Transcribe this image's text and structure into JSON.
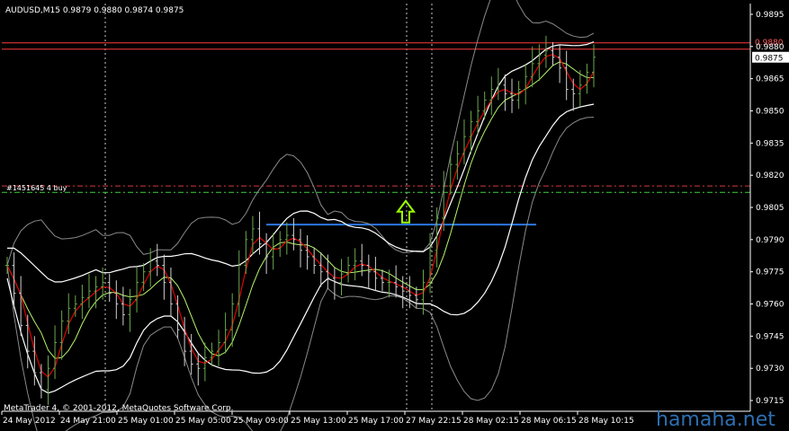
{
  "colors": {
    "background": "#000000",
    "axis": "#ffffff",
    "grid": "#c8c8c8",
    "bars": "#6aa84f",
    "bars_alt": "#d0d0d0",
    "red_ma": "#e00000",
    "lime_ma": "#b7f56b",
    "white_ma": "#ffffff",
    "envelope": "#8a8a8a",
    "resistance_line": "#ff3b3b",
    "blue_line": "#2b78e4",
    "dash_red": "#d23a3a",
    "dash_green": "#3fcf3f",
    "arrow": "#9cff00",
    "price_tag_bg": "#ffffff"
  },
  "chart_data": {
    "type": "candlestick",
    "title": "AUDUSD,M15  0.9879 0.9880 0.9874 0.9875",
    "symbol": "AUDUSD",
    "timeframe": "M15",
    "ohlc": {
      "open": 0.9879,
      "high": 0.988,
      "low": 0.9874,
      "close": 0.9875
    },
    "ylim": [
      0.971,
      0.99
    ],
    "y_ticks": [
      "0.9895",
      "0.9880",
      "0.9865",
      "0.9850",
      "0.9835",
      "0.9820",
      "0.9805",
      "0.9790",
      "0.9775",
      "0.9760",
      "0.9745",
      "0.9730",
      "0.9715"
    ],
    "x_ticks": [
      "24 May 2012",
      "24 May 21:00",
      "25 May 01:00",
      "25 May 05:00",
      "25 May 09:00",
      "25 May 13:00",
      "25 May 17:00",
      "27 May 22:15",
      "28 May 02:15",
      "28 May 06:15",
      "28 May 10:15"
    ],
    "current_price": "0.9875",
    "red_level_label": "0.9880",
    "red_level": 0.988,
    "blue_level": 0.9797,
    "order_label": "#1451645 4 buy",
    "order_level": 0.9815,
    "order_stop_level": 0.9812,
    "close": [
      0.9778,
      0.9765,
      0.975,
      0.9738,
      0.9728,
      0.972,
      0.973,
      0.9742,
      0.9752,
      0.9758,
      0.976,
      0.9763,
      0.9766,
      0.9768,
      0.977,
      0.9765,
      0.976,
      0.9755,
      0.9762,
      0.977,
      0.9775,
      0.978,
      0.9778,
      0.977,
      0.976,
      0.9748,
      0.9738,
      0.9732,
      0.973,
      0.9735,
      0.9738,
      0.9742,
      0.9748,
      0.976,
      0.9778,
      0.979,
      0.9795,
      0.9788,
      0.9782,
      0.9786,
      0.979,
      0.9792,
      0.979,
      0.9785,
      0.9782,
      0.9778,
      0.9775,
      0.9772,
      0.977,
      0.9774,
      0.9778,
      0.978,
      0.9778,
      0.9775,
      0.9772,
      0.977,
      0.977,
      0.9768,
      0.9766,
      0.9764,
      0.9762,
      0.977,
      0.9785,
      0.98,
      0.9815,
      0.9825,
      0.983,
      0.9838,
      0.9845,
      0.985,
      0.9855,
      0.986,
      0.9862,
      0.9858,
      0.9855,
      0.986,
      0.9866,
      0.9872,
      0.9876,
      0.9878,
      0.9875,
      0.987,
      0.986,
      0.9858,
      0.9862,
      0.9868,
      0.9875
    ],
    "series": [
      {
        "key": "red_ma"
      },
      {
        "key": "lime_ma"
      },
      {
        "key": "white_upper"
      },
      {
        "key": "white_lower"
      },
      {
        "key": "envelope_upper"
      },
      {
        "key": "envelope_lower"
      }
    ]
  },
  "credit": "MetaTrader 4, © 2001-2012, MetaQuotes Software Corp.",
  "watermark": "hamaha.net"
}
